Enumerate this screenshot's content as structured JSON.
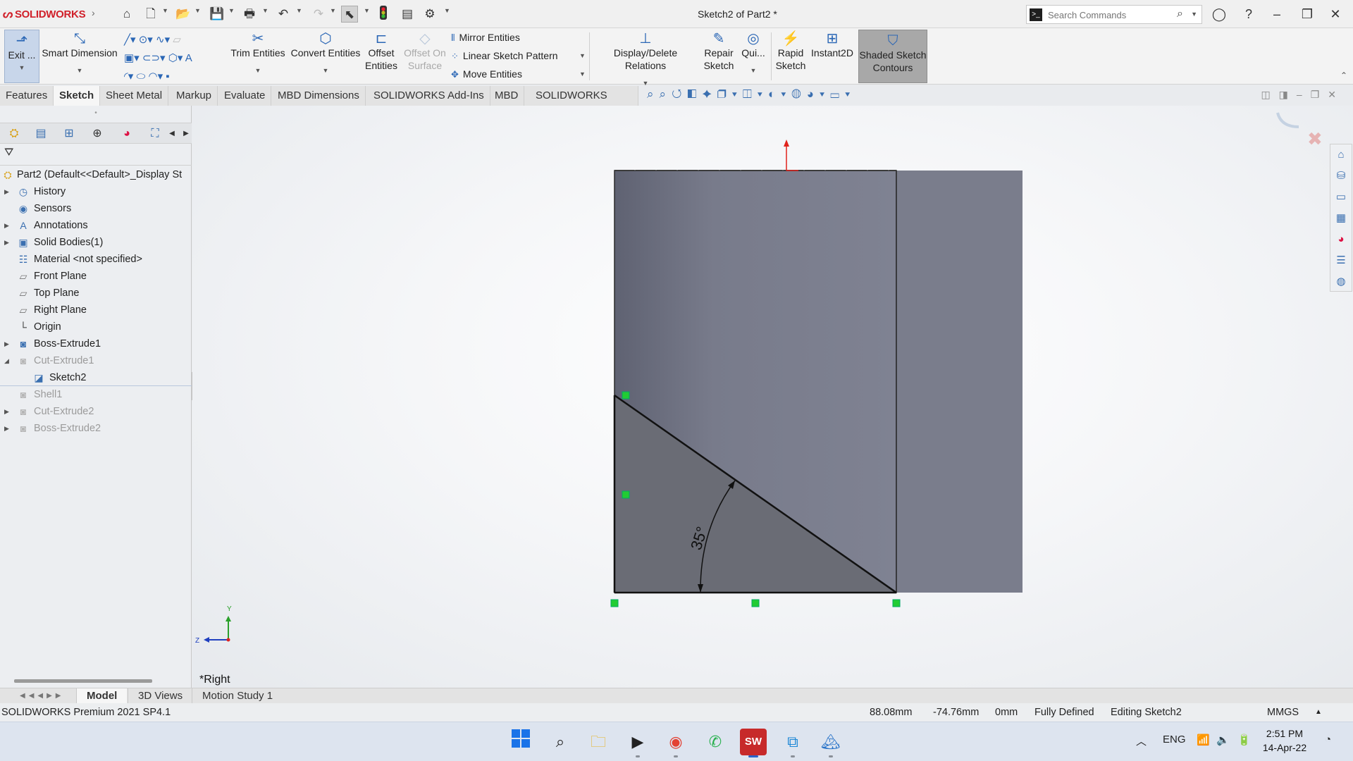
{
  "titlebar": {
    "app_name": "SOLIDWORKS",
    "doc_title": "Sketch2 of Part2 *",
    "search_placeholder": "Search Commands"
  },
  "command_manager": {
    "exit": "Exit ...",
    "smart_dimension": "Smart Dimension",
    "trim_entities": "Trim Entities",
    "convert_entities": "Convert Entities",
    "offset_entities_1": "Offset",
    "offset_entities_2": "Entities",
    "offset_on_surface_1": "Offset On",
    "offset_on_surface_2": "Surface",
    "mirror_entities": "Mirror Entities",
    "linear_sketch_pattern": "Linear Sketch Pattern",
    "move_entities": "Move Entities",
    "display_delete_relations": "Display/Delete Relations",
    "repair_sketch_1": "Repair",
    "repair_sketch_2": "Sketch",
    "quick_snaps": "Qui...",
    "rapid_sketch_1": "Rapid",
    "rapid_sketch_2": "Sketch",
    "instant2d": "Instant2D",
    "shaded_sketch_contours_1": "Shaded Sketch",
    "shaded_sketch_contours_2": "Contours"
  },
  "tabs": [
    {
      "label": "Features"
    },
    {
      "label": "Sketch"
    },
    {
      "label": "Sheet Metal"
    },
    {
      "label": "Markup"
    },
    {
      "label": "Evaluate"
    },
    {
      "label": "MBD Dimensions"
    },
    {
      "label": "SOLIDWORKS Add-Ins"
    },
    {
      "label": "MBD"
    },
    {
      "label": "SOLIDWORKS CAM"
    }
  ],
  "tree": {
    "root": "Part2  (Default<<Default>_Display St",
    "items": [
      {
        "label": "History"
      },
      {
        "label": "Sensors"
      },
      {
        "label": "Annotations"
      },
      {
        "label": "Solid Bodies(1)"
      },
      {
        "label": "Material <not specified>"
      },
      {
        "label": "Front Plane"
      },
      {
        "label": "Top Plane"
      },
      {
        "label": "Right Plane"
      },
      {
        "label": "Origin"
      },
      {
        "label": "Boss-Extrude1"
      },
      {
        "label": "Cut-Extrude1"
      },
      {
        "label": "Sketch2"
      },
      {
        "label": "Shell1"
      },
      {
        "label": "Cut-Extrude2"
      },
      {
        "label": "Boss-Extrude2"
      }
    ]
  },
  "graphics": {
    "dimension_label": "35°",
    "view_label": "*Right",
    "triad_y": "Y",
    "triad_z": "Z",
    "body_color": "#7a7d8c",
    "sketch_region_color": "#6a6c75"
  },
  "bottom_tabs": [
    {
      "label": "Model"
    },
    {
      "label": "3D Views"
    },
    {
      "label": "Motion Study 1"
    }
  ],
  "status": {
    "product": "SOLIDWORKS Premium 2021 SP4.1",
    "x": "88.08mm",
    "y": "-74.76mm",
    "z": "0mm",
    "state": "Fully Defined",
    "editing": "Editing Sketch2",
    "units": "MMGS"
  },
  "taskbar": {
    "lang": "ENG",
    "time": "2:51 PM",
    "date": "14-Apr-22"
  }
}
